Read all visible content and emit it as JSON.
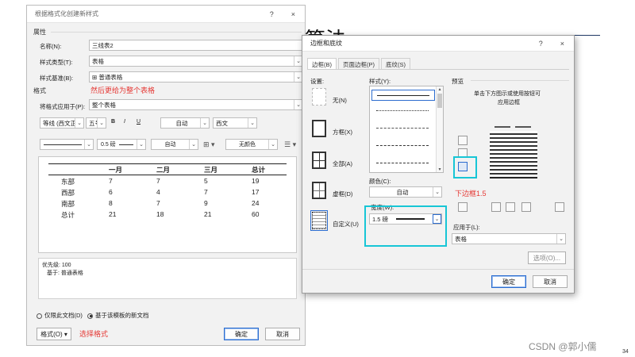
{
  "background": {
    "title_partial": "算法",
    "watermark": "CSDN @郭小儒",
    "slide_number": "34"
  },
  "main_dialog": {
    "title": "根据格式化创建新样式",
    "title_buttons": [
      "?",
      "×"
    ],
    "section_properties": "属性",
    "name_label": "名称(N):",
    "name_value": "三线表2",
    "style_type_label": "样式类型(T):",
    "style_type_value": "表格",
    "based_on_label": "样式基准(B):",
    "based_on_value": "⊞ 普通表格",
    "annotation_apply": "然后更给为整个表格",
    "section_format": "格式",
    "apply_to_label": "将格式应用于(P):",
    "apply_to_value": "整个表格",
    "font_name": "等线 (西文正文)",
    "font_size": "五号",
    "bold": "B",
    "italic": "I",
    "underline": "U",
    "font_color": "自动",
    "script": "西文",
    "line_weight": "0.5 磅",
    "border_color": "自动",
    "shading": "无颜色",
    "preview_table": {
      "headers": [
        "",
        "一月",
        "二月",
        "三月",
        "总计"
      ],
      "rows": [
        [
          "东部",
          "7",
          "7",
          "5",
          "19"
        ],
        [
          "西部",
          "6",
          "4",
          "7",
          "17"
        ],
        [
          "南部",
          "8",
          "7",
          "9",
          "24"
        ],
        [
          "总计",
          "21",
          "18",
          "21",
          "60"
        ]
      ]
    },
    "description_line1": "优先级: 100",
    "description_line2": "基于: 普通表格",
    "radio_doc_only": "仅限此文档(D)",
    "radio_new_docs": "基于该模板的新文档",
    "format_button": "格式(O) ▾",
    "annotation_format": "选择格式",
    "ok": "确定",
    "cancel": "取消"
  },
  "border_dialog": {
    "title": "边框和底纹",
    "title_buttons": [
      "?",
      "×"
    ],
    "tabs": [
      "边框(B)",
      "页面边框(P)",
      "底纹(S)"
    ],
    "setting_label": "设置:",
    "settings": [
      "无(N)",
      "方框(X)",
      "全部(A)",
      "虚框(D)",
      "自定义(U)"
    ],
    "style_label": "样式(Y):",
    "color_label": "颜色(C):",
    "color_value": "自动",
    "width_label": "宽度(W):",
    "width_value": "1.5 磅",
    "preview_label": "预览",
    "preview_hint_line1": "单击下方图示或使用按钮可",
    "preview_hint_line2": "应用边框",
    "annotation_bottom": "下边框1.5",
    "apply_to_label": "应用于(L):",
    "apply_to_value": "表格",
    "options_button": "选项(O)...",
    "ok": "确定",
    "cancel": "取消"
  },
  "colors": {
    "annotation_red": "#e53935",
    "highlight_cyan": "#17c6d6",
    "primary_border": "#2b6ccf"
  }
}
